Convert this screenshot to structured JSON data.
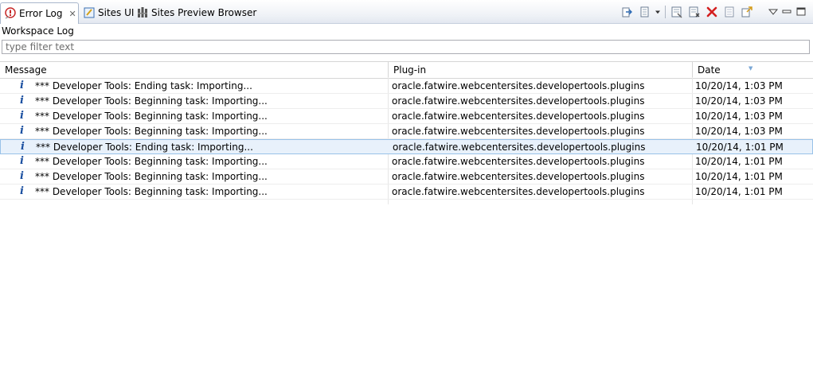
{
  "tabs": [
    {
      "label": "Error Log",
      "icon": "error-log-icon",
      "active": true
    },
    {
      "label": "Sites UI",
      "icon": "sites-ui-icon",
      "active": false
    },
    {
      "label": "Sites Preview Browser",
      "icon": "preview-browser-icon",
      "active": false
    }
  ],
  "toolbar_icons": [
    "export-log-icon",
    "import-log-icon",
    "dropdown-icon",
    "clear-log-viewer-icon",
    "delete-log-icon",
    "delete-icon",
    "open-log-icon",
    "restore-log-icon",
    "view-menu-icon",
    "minimize-icon",
    "maximize-icon"
  ],
  "workspace_label": "Workspace Log",
  "filter": {
    "placeholder": "type filter text",
    "value": ""
  },
  "table": {
    "columns": [
      "Message",
      "Plug-in",
      "Date"
    ],
    "rows": [
      {
        "message": "*** Developer Tools: Ending task: Importing...",
        "plugin": "oracle.fatwire.webcentersites.developertools.plugins",
        "date": "10/20/14, 1:03 PM"
      },
      {
        "message": "*** Developer Tools: Beginning task: Importing...",
        "plugin": "oracle.fatwire.webcentersites.developertools.plugins",
        "date": "10/20/14, 1:03 PM"
      },
      {
        "message": "*** Developer Tools: Beginning task: Importing...",
        "plugin": "oracle.fatwire.webcentersites.developertools.plugins",
        "date": "10/20/14, 1:03 PM"
      },
      {
        "message": "*** Developer Tools: Beginning task: Importing...",
        "plugin": "oracle.fatwire.webcentersites.developertools.plugins",
        "date": "10/20/14, 1:03 PM"
      },
      {
        "message": "*** Developer Tools: Ending task: Importing...",
        "plugin": "oracle.fatwire.webcentersites.developertools.plugins",
        "date": "10/20/14, 1:01 PM"
      },
      {
        "message": "*** Developer Tools: Beginning task: Importing...",
        "plugin": "oracle.fatwire.webcentersites.developertools.plugins",
        "date": "10/20/14, 1:01 PM"
      },
      {
        "message": "*** Developer Tools: Beginning task: Importing...",
        "plugin": "oracle.fatwire.webcentersites.developertools.plugins",
        "date": "10/20/14, 1:01 PM"
      },
      {
        "message": "*** Developer Tools: Beginning task: Importing...",
        "plugin": "oracle.fatwire.webcentersites.developertools.plugins",
        "date": "10/20/14, 1:01 PM"
      }
    ],
    "selected_row": 4
  },
  "colors": {
    "accent_blue": "#1a4fa0",
    "delete_red": "#d42020",
    "selection": "#e8f1fb"
  }
}
